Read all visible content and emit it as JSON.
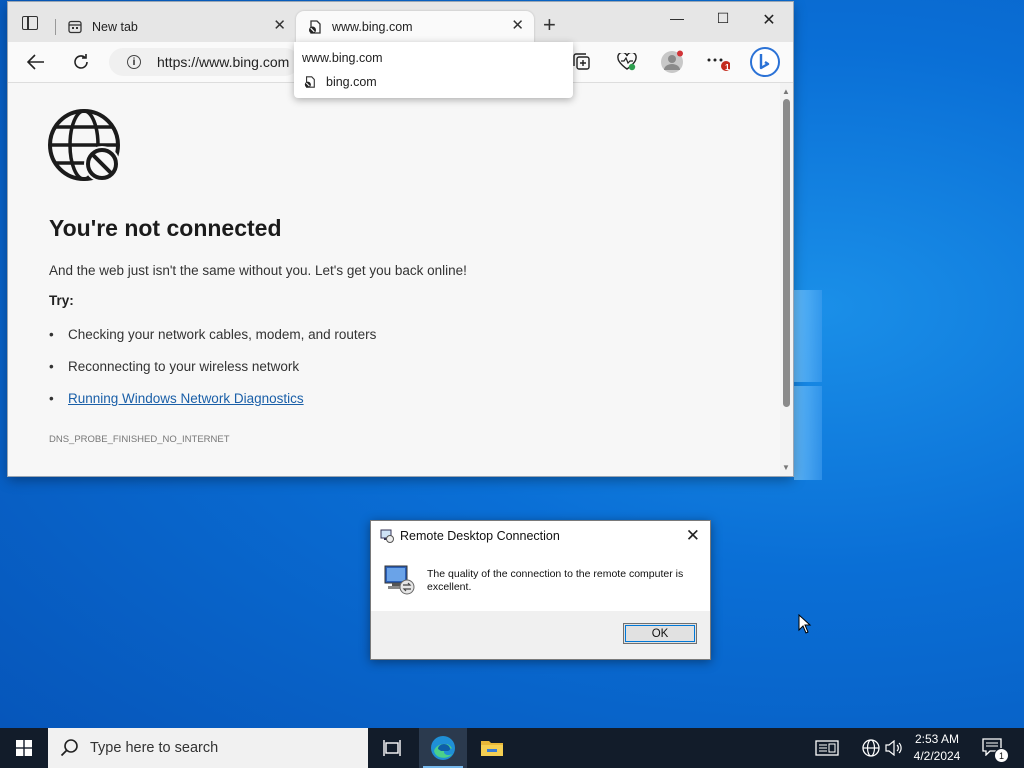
{
  "browser": {
    "tabs": [
      {
        "label": "New tab",
        "active": false
      },
      {
        "label": "www.bing.com",
        "active": true
      }
    ],
    "address": "https://www.bing.com",
    "dropdown": {
      "header": "www.bing.com",
      "suggestion": "bing.com"
    },
    "page": {
      "title": "You're not connected",
      "lead": "And the web just isn't the same without you. Let's get you back online!",
      "try_label": "Try:",
      "suggestions": [
        "Checking your network cables, modem, and routers",
        "Reconnecting to your wireless network",
        "Running Windows Network Diagnostics"
      ],
      "error_code": "DNS_PROBE_FINISHED_NO_INTERNET"
    },
    "notification_badge": "1"
  },
  "dialog": {
    "title": "Remote Desktop Connection",
    "message": "The quality of the connection to the remote computer is excellent.",
    "ok_label": "OK"
  },
  "taskbar": {
    "search_placeholder": "Type here to search",
    "time": "2:53 AM",
    "date": "4/2/2024",
    "notification_count": "1"
  },
  "colors": {
    "accent": "#0078d7",
    "link": "#1a5fa8",
    "taskbar": "#121c2a",
    "desktop": "#0a6fd6"
  }
}
